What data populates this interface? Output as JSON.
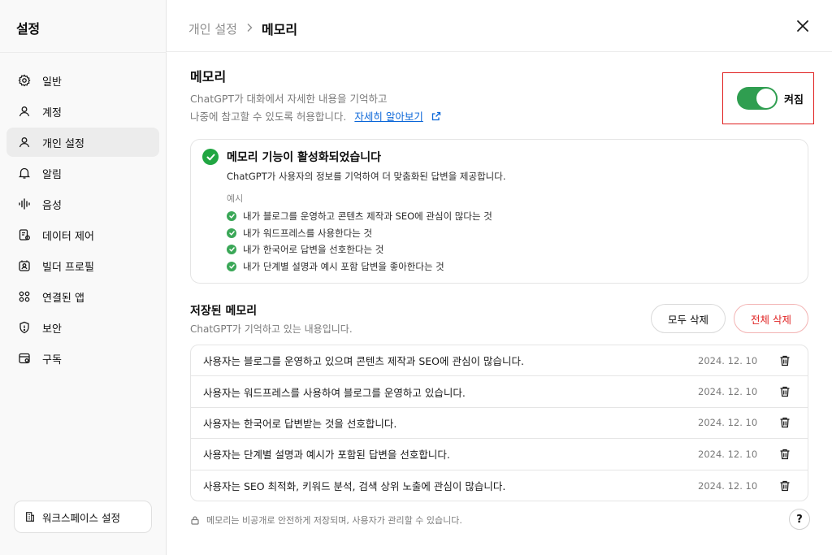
{
  "sidebar": {
    "title": "설정",
    "items": [
      {
        "label": "일반",
        "icon": "gear-icon"
      },
      {
        "label": "계정",
        "icon": "user-icon"
      },
      {
        "label": "개인 설정",
        "icon": "user-icon"
      },
      {
        "label": "알림",
        "icon": "bell-icon"
      },
      {
        "label": "음성",
        "icon": "waveform-icon"
      },
      {
        "label": "데이터 제어",
        "icon": "data-icon"
      },
      {
        "label": "빌더 프로필",
        "icon": "profile-card-icon"
      },
      {
        "label": "연결된 앱",
        "icon": "apps-grid-icon"
      },
      {
        "label": "보안",
        "icon": "shield-icon"
      },
      {
        "label": "구독",
        "icon": "subscription-icon"
      }
    ],
    "workspace_label": "워크스페이스 설정"
  },
  "header": {
    "breadcrumb_parent": "개인 설정",
    "breadcrumb_current": "메모리"
  },
  "memory": {
    "title": "메모리",
    "desc_line1": "ChatGPT가 대화에서 자세한 내용을 기억하고",
    "desc_line2": "나중에 참고할 수 있도록 허용합니다.",
    "learn_more": "자세히 알아보기",
    "toggle_label": "켜짐",
    "toggle_on": true
  },
  "info": {
    "title": "메모리 기능이 활성화되었습니다",
    "subtitle": "ChatGPT가 사용자의 정보를 기억하여 더 맞춤화된 답변을 제공합니다.",
    "examples_label": "예시",
    "examples": [
      "내가 블로그를 운영하고 콘텐츠 제작과 SEO에 관심이 많다는 것",
      "내가 워드프레스를 사용한다는 것",
      "내가 한국어로 답변을 선호한다는 것",
      "내가 단계별 설명과 예시 포함 답변을 좋아한다는 것"
    ]
  },
  "saved": {
    "title": "저장된 메모리",
    "subtitle": "ChatGPT가 기억하고 있는 내용입니다.",
    "manage_all": "모두 삭제",
    "delete_all": "전체 삭제",
    "rows": [
      {
        "text": "사용자는 블로그를 운영하고 있으며 콘텐츠 제작과 SEO에 관심이 많습니다.",
        "date": "2024. 12. 10"
      },
      {
        "text": "사용자는 워드프레스를 사용하여 블로그를 운영하고 있습니다.",
        "date": "2024. 12. 10"
      },
      {
        "text": "사용자는 한국어로 답변받는 것을 선호합니다.",
        "date": "2024. 12. 10"
      },
      {
        "text": "사용자는 단계별 설명과 예시가 포함된 답변을 선호합니다.",
        "date": "2024. 12. 10"
      },
      {
        "text": "사용자는 SEO 최적화, 키워드 분석, 검색 상위 노출에 관심이 많습니다.",
        "date": "2024. 12. 10"
      }
    ]
  },
  "footer": {
    "text": "메모리는 비공개로 안전하게 저장되며, 사용자가 관리할 수 있습니다.",
    "help": "?"
  },
  "colors": {
    "toggle_on": "#2f9e50",
    "check": "#21a642",
    "danger": "#e02424",
    "link": "#0a66d8"
  }
}
